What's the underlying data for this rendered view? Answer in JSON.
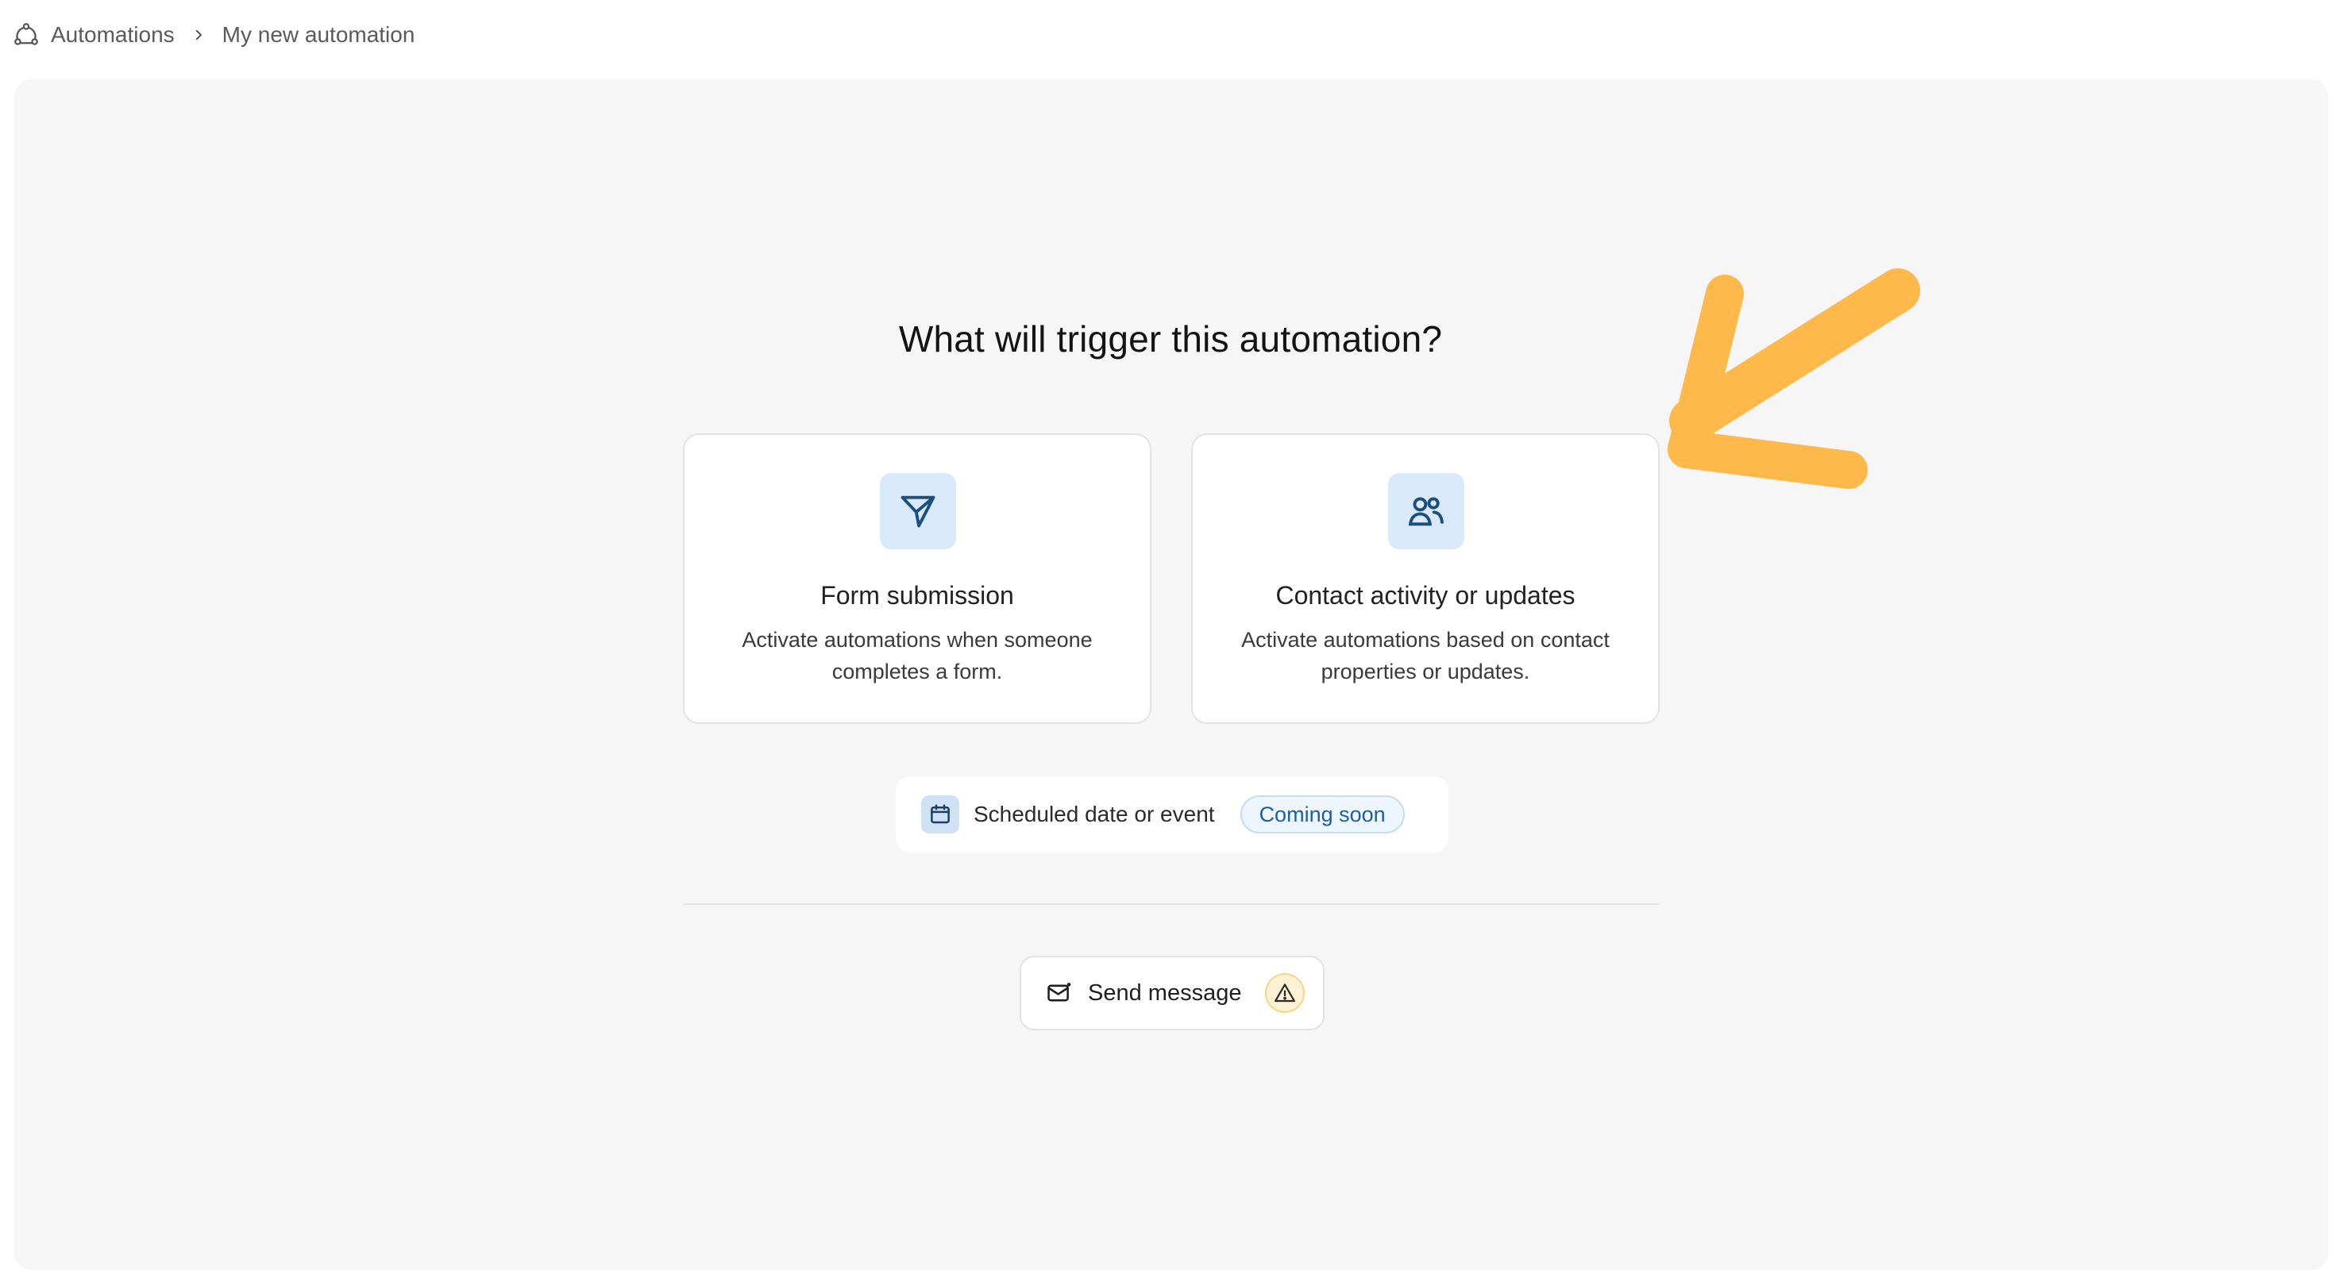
{
  "breadcrumb": {
    "icon": "automation-icon",
    "parent": "Automations",
    "separator_icon": "chevron-right-icon",
    "current": "My new automation"
  },
  "main": {
    "title": "What will trigger this automation?",
    "triggers": [
      {
        "icon": "send-plane-icon",
        "title": "Form submission",
        "description": "Activate automations when someone completes a form."
      },
      {
        "icon": "users-icon",
        "title": "Contact activity or updates",
        "description": "Activate automations based on contact properties or updates."
      }
    ],
    "scheduled": {
      "icon": "calendar-icon",
      "label": "Scheduled date or event",
      "badge": "Coming soon"
    },
    "action": {
      "icon": "mail-icon",
      "label": "Send message",
      "status_icon": "warning-icon"
    }
  },
  "colors": {
    "canvas_bg": "#f6f6f6",
    "icon_tile_bg": "#dbeafb",
    "icon_stroke": "#1d4f7c",
    "badge_text": "#1d5e9e",
    "annotation_arrow": "#ffb84a",
    "warning_bg": "#fdf1d4"
  }
}
